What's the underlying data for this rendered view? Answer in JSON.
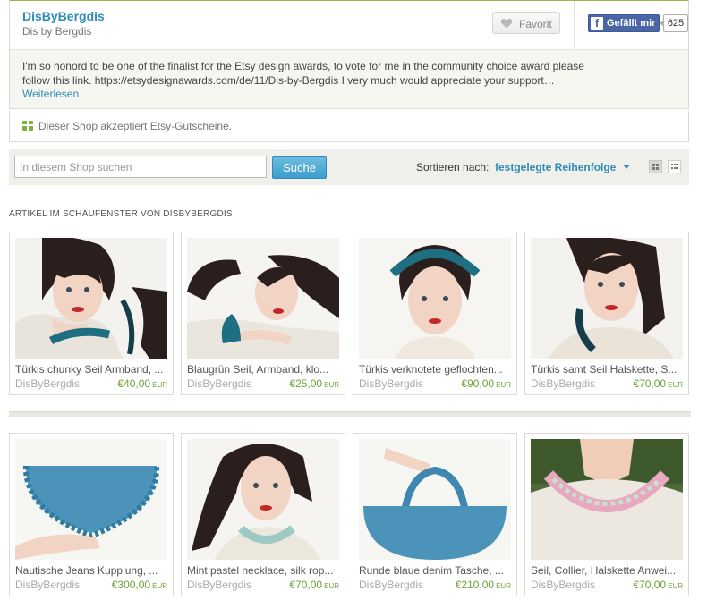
{
  "shop": {
    "name": "DisByBergdis",
    "subtitle": "Dis by Bergdis",
    "favorite_label": "Favorit",
    "fb_like_label": "Gefällt mir",
    "fb_like_count": "625",
    "announcement": "I'm so honord to be one of the finalist for the Etsy design awards, to vote for me in the community choice award please follow this link. https://etsydesignawards.com/de/11/Dis-by-Bergdis I very much would appreciate your support…",
    "read_more": "Weiterlesen",
    "gift_card_text": "Dieser Shop akzeptiert Etsy-Gutscheine."
  },
  "search": {
    "placeholder": "In diesem Shop suchen",
    "button_label": "Suche",
    "sort_label": "Sortieren nach:",
    "sort_value": "festgelegte Reihenfolge"
  },
  "section_title": "ARTIKEL IM SCHAUFENSTER VON DISBYBERGDIS",
  "colors": {
    "accent": "#2e8bb8",
    "price": "#6fa23b",
    "brand_green": "#9cb84a"
  },
  "listings": [
    {
      "title": "Türkis chunky Seil Armband, ...",
      "seller": "DisByBergdis",
      "price": "€40,00",
      "currency": "EUR"
    },
    {
      "title": "Blaugrün Seil, Armband, klo...",
      "seller": "DisByBergdis",
      "price": "€25,00",
      "currency": "EUR"
    },
    {
      "title": "Türkis verknotete geflochten...",
      "seller": "DisByBergdis",
      "price": "€90,00",
      "currency": "EUR"
    },
    {
      "title": "Türkis samt Seil Halskette, S...",
      "seller": "DisByBergdis",
      "price": "€70,00",
      "currency": "EUR"
    },
    {
      "title": "Nautische Jeans Kupplung, ...",
      "seller": "DisByBergdis",
      "price": "€300,00",
      "currency": "EUR"
    },
    {
      "title": "Mint pastel necklace, silk rop...",
      "seller": "DisByBergdis",
      "price": "€70,00",
      "currency": "EUR"
    },
    {
      "title": "Runde blaue denim Tasche, ...",
      "seller": "DisByBergdis",
      "price": "€210,00",
      "currency": "EUR"
    },
    {
      "title": "Seil, Collier, Halskette Anwei...",
      "seller": "DisByBergdis",
      "price": "€70,00",
      "currency": "EUR"
    }
  ]
}
